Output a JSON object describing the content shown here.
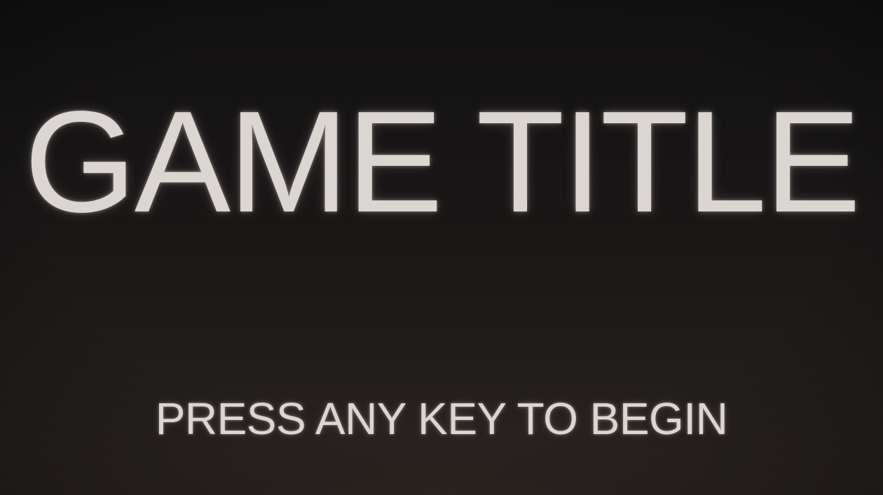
{
  "title_screen": {
    "title": "GAME TITLE",
    "prompt": "PRESS ANY KEY TO BEGIN"
  }
}
